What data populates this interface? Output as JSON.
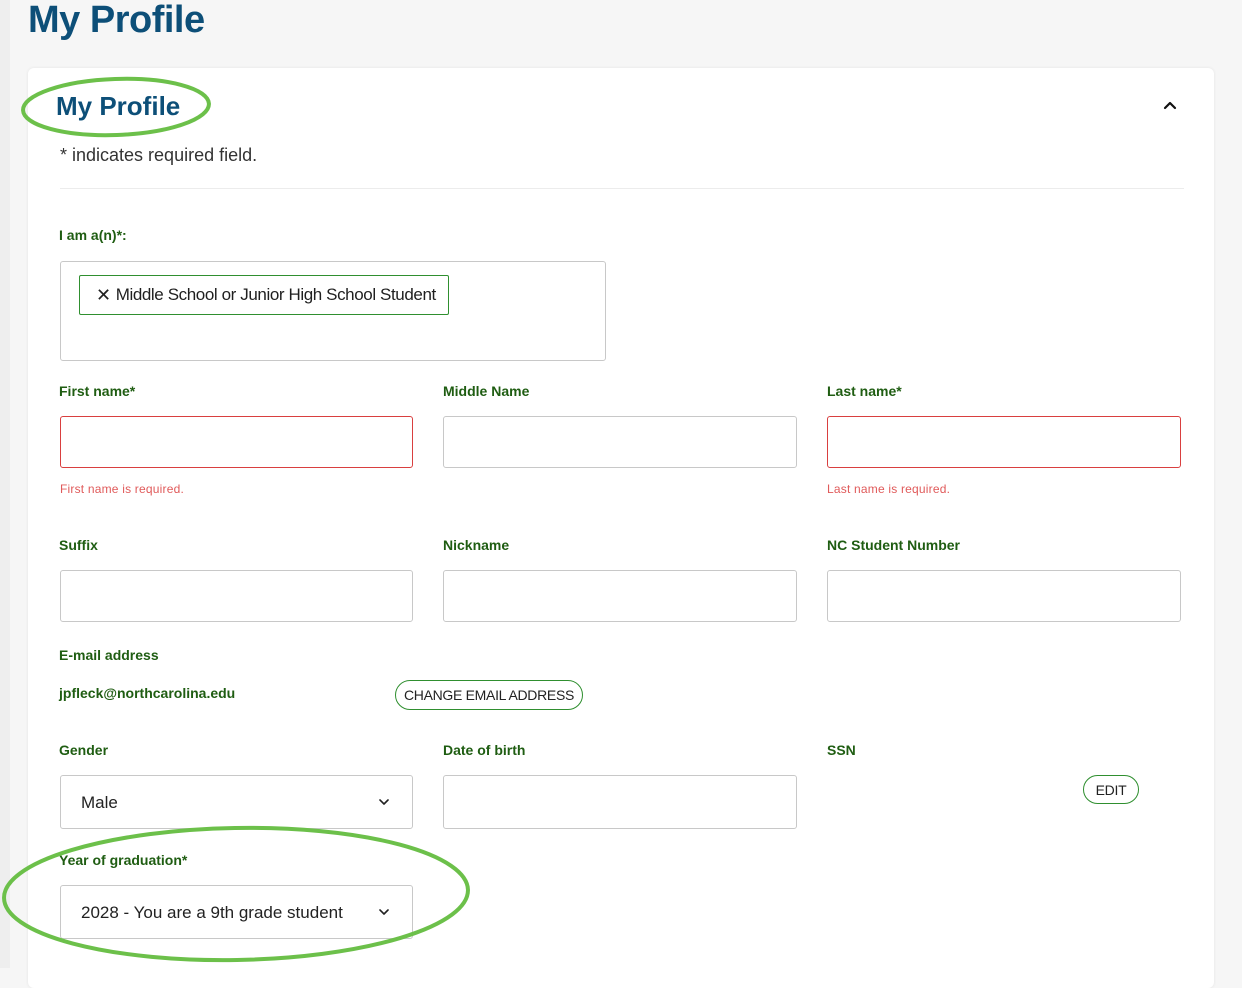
{
  "page": {
    "title": "My Profile"
  },
  "section": {
    "title": "My Profile",
    "required_note": "* indicates required field."
  },
  "role": {
    "label": "I am a(n)*:",
    "selected": "Middle School or Junior High School Student",
    "remove_icon": "x-icon"
  },
  "fields": {
    "first_name": {
      "label": "First name*",
      "value": "",
      "error": "First name is required."
    },
    "middle_name": {
      "label": "Middle Name",
      "value": ""
    },
    "last_name": {
      "label": "Last name*",
      "value": "",
      "error": "Last name is required."
    },
    "suffix": {
      "label": "Suffix",
      "value": ""
    },
    "nickname": {
      "label": "Nickname",
      "value": ""
    },
    "nc_student_number": {
      "label": "NC Student Number",
      "value": ""
    },
    "email": {
      "label": "E-mail address",
      "value": "jpfleck@northcarolina.edu",
      "change_button": "CHANGE EMAIL ADDRESS"
    },
    "gender": {
      "label": "Gender",
      "value": "Male"
    },
    "date_of_birth": {
      "label": "Date of birth",
      "value": ""
    },
    "ssn": {
      "label": "SSN",
      "edit_button": "EDIT"
    },
    "graduation_year": {
      "label": "Year of graduation*",
      "value": "2028 - You are a 9th grade student"
    }
  },
  "colors": {
    "title": "#0d4f78",
    "label": "#1f5d12",
    "error": "#d93f3f",
    "annotation": "#6cc04a",
    "accent_border": "#2f8f2f"
  },
  "icons": {
    "collapse": "chevron-up-icon",
    "dropdown": "chevron-down-icon"
  }
}
